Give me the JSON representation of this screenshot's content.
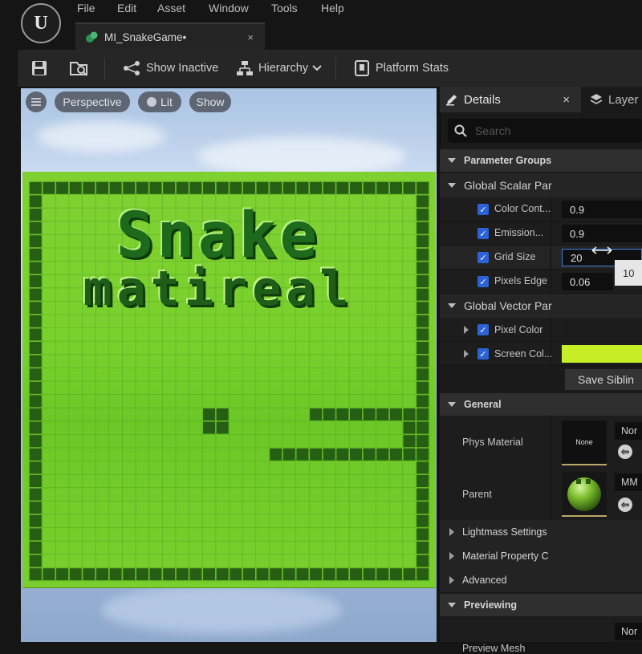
{
  "menu": [
    "File",
    "Edit",
    "Asset",
    "Window",
    "Tools",
    "Help"
  ],
  "tab": {
    "title": "MI_SnakeGame•",
    "close": "×"
  },
  "toolbar": {
    "show_inactive": "Show Inactive",
    "hierarchy": "Hierarchy",
    "platform_stats": "Platform Stats"
  },
  "viewport": {
    "perspective": "Perspective",
    "lit": "Lit",
    "show": "Show"
  },
  "overlay": {
    "title_line1": "Snake",
    "title_line2": "matireal"
  },
  "details": {
    "tab_label": "Details",
    "tab_close": "×",
    "layers_tab": "Layer",
    "search_placeholder": "Search",
    "parameter_groups": "Parameter Groups",
    "global_scalar": "Global Scalar Par",
    "scalar_params": [
      {
        "name": "Color Cont...",
        "value": "0.9"
      },
      {
        "name": "Emission...",
        "value": "0.9"
      },
      {
        "name": "Grid Size",
        "value": "20"
      },
      {
        "name": "Pixels Edge",
        "value": "0.06"
      }
    ],
    "tooltip_value": "10",
    "global_vector": "Global Vector Par",
    "vector_params": [
      {
        "name": "Pixel Color",
        "color": "#1b1b1b"
      },
      {
        "name": "Screen Col...",
        "color": "#c5ee26"
      }
    ],
    "save_siblings": "Save Siblin",
    "general": "General",
    "phys_material": {
      "label": "Phys Material",
      "thumb": "None",
      "value": "Nor"
    },
    "parent": {
      "label": "Parent",
      "value": "MM"
    },
    "collapsed": [
      "Lightmass Settings",
      "Material Property C",
      "Advanced"
    ],
    "previewing": "Previewing",
    "preview_mesh": "Preview Mesh"
  },
  "snake": {
    "board_rows": 30,
    "board_cols": 30,
    "food": [
      [
        17,
        13
      ]
    ],
    "body": [
      [
        20,
        18
      ],
      [
        20,
        19
      ],
      [
        20,
        20
      ],
      [
        20,
        21
      ],
      [
        20,
        22
      ],
      [
        20,
        23
      ],
      [
        20,
        24
      ],
      [
        20,
        25
      ],
      [
        20,
        26
      ],
      [
        20,
        27
      ],
      [
        20,
        28
      ],
      [
        19,
        28
      ],
      [
        18,
        28
      ],
      [
        17,
        28
      ],
      [
        17,
        27
      ],
      [
        17,
        26
      ],
      [
        17,
        25
      ],
      [
        17,
        24
      ],
      [
        17,
        23
      ],
      [
        17,
        22
      ],
      [
        17,
        21
      ],
      [
        18,
        28
      ]
    ]
  },
  "colors": {
    "board": "#7ccf2e",
    "cell_dark": "#265e14",
    "accent": "#2b63d6"
  }
}
